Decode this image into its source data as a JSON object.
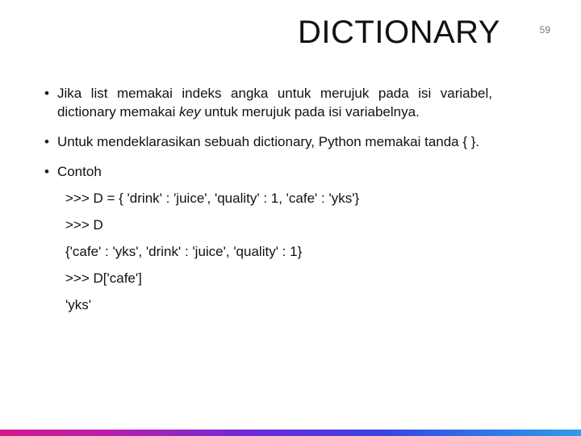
{
  "page_number": "59",
  "title": "DICTIONARY",
  "bullets": {
    "b1_pre": "Jika list memakai indeks angka untuk merujuk pada isi variabel, dictionary memakai ",
    "b1_italic": "key",
    "b1_post": " untuk merujuk pada isi variabelnya.",
    "b2": "Untuk mendeklarasikan sebuah dictionary, Python memakai tanda { }.",
    "b3": "Contoh"
  },
  "code": {
    "l1": ">>> D = { 'drink' : 'juice', 'quality' : 1, 'cafe' : 'yks'}",
    "l2": ">>> D",
    "l3": " {'cafe' : 'yks', 'drink' : 'juice', 'quality' : 1}",
    "l4": ">>> D['cafe']",
    "l5": "'yks'"
  }
}
